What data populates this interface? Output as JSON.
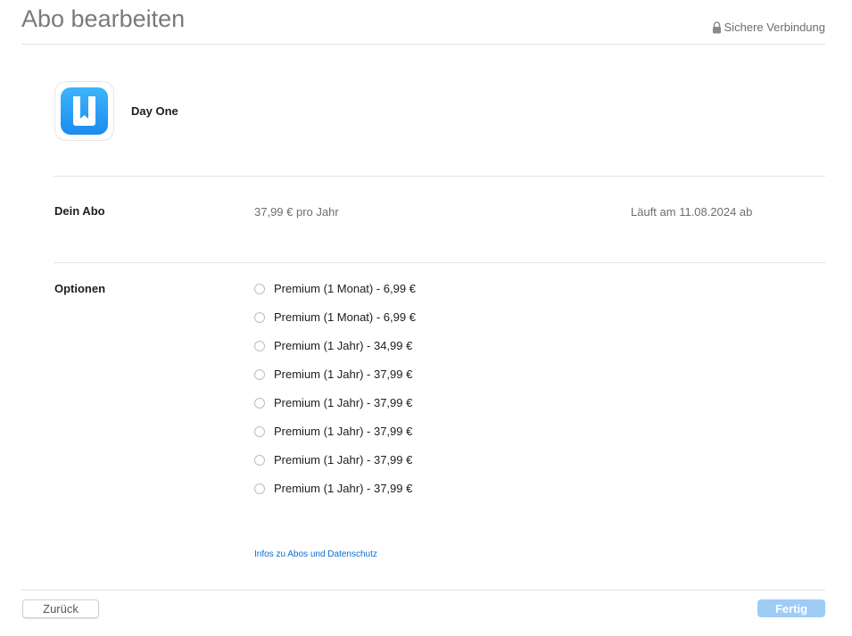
{
  "header": {
    "title": "Abo bearbeiten",
    "secure_label": "Sichere Verbindung",
    "secure_icon": "lock-icon"
  },
  "app": {
    "name": "Day One",
    "icon": "day-one-app-icon",
    "icon_color": "#2a9bf5"
  },
  "subscription": {
    "label": "Dein Abo",
    "price": "37,99 € pro Jahr",
    "expiry": "Läuft am 11.08.2024 ab"
  },
  "options": {
    "label": "Optionen",
    "items": [
      {
        "label": "Premium (1 Monat) - 6,99 €"
      },
      {
        "label": "Premium (1 Monat) - 6,99 €"
      },
      {
        "label": "Premium (1 Jahr) - 34,99 €"
      },
      {
        "label": "Premium (1 Jahr) - 37,99 €"
      },
      {
        "label": "Premium (1 Jahr) - 37,99 €"
      },
      {
        "label": "Premium (1 Jahr) - 37,99 €"
      },
      {
        "label": "Premium (1 Jahr) - 37,99 €"
      },
      {
        "label": "Premium (1 Jahr) - 37,99 €"
      }
    ]
  },
  "privacy_link": "Infos zu Abos und Datenschutz",
  "footer": {
    "back_label": "Zurück",
    "done_label": "Fertig"
  },
  "colors": {
    "accent": "#0a6ed1",
    "done_button_disabled": "#9fcbf7"
  }
}
